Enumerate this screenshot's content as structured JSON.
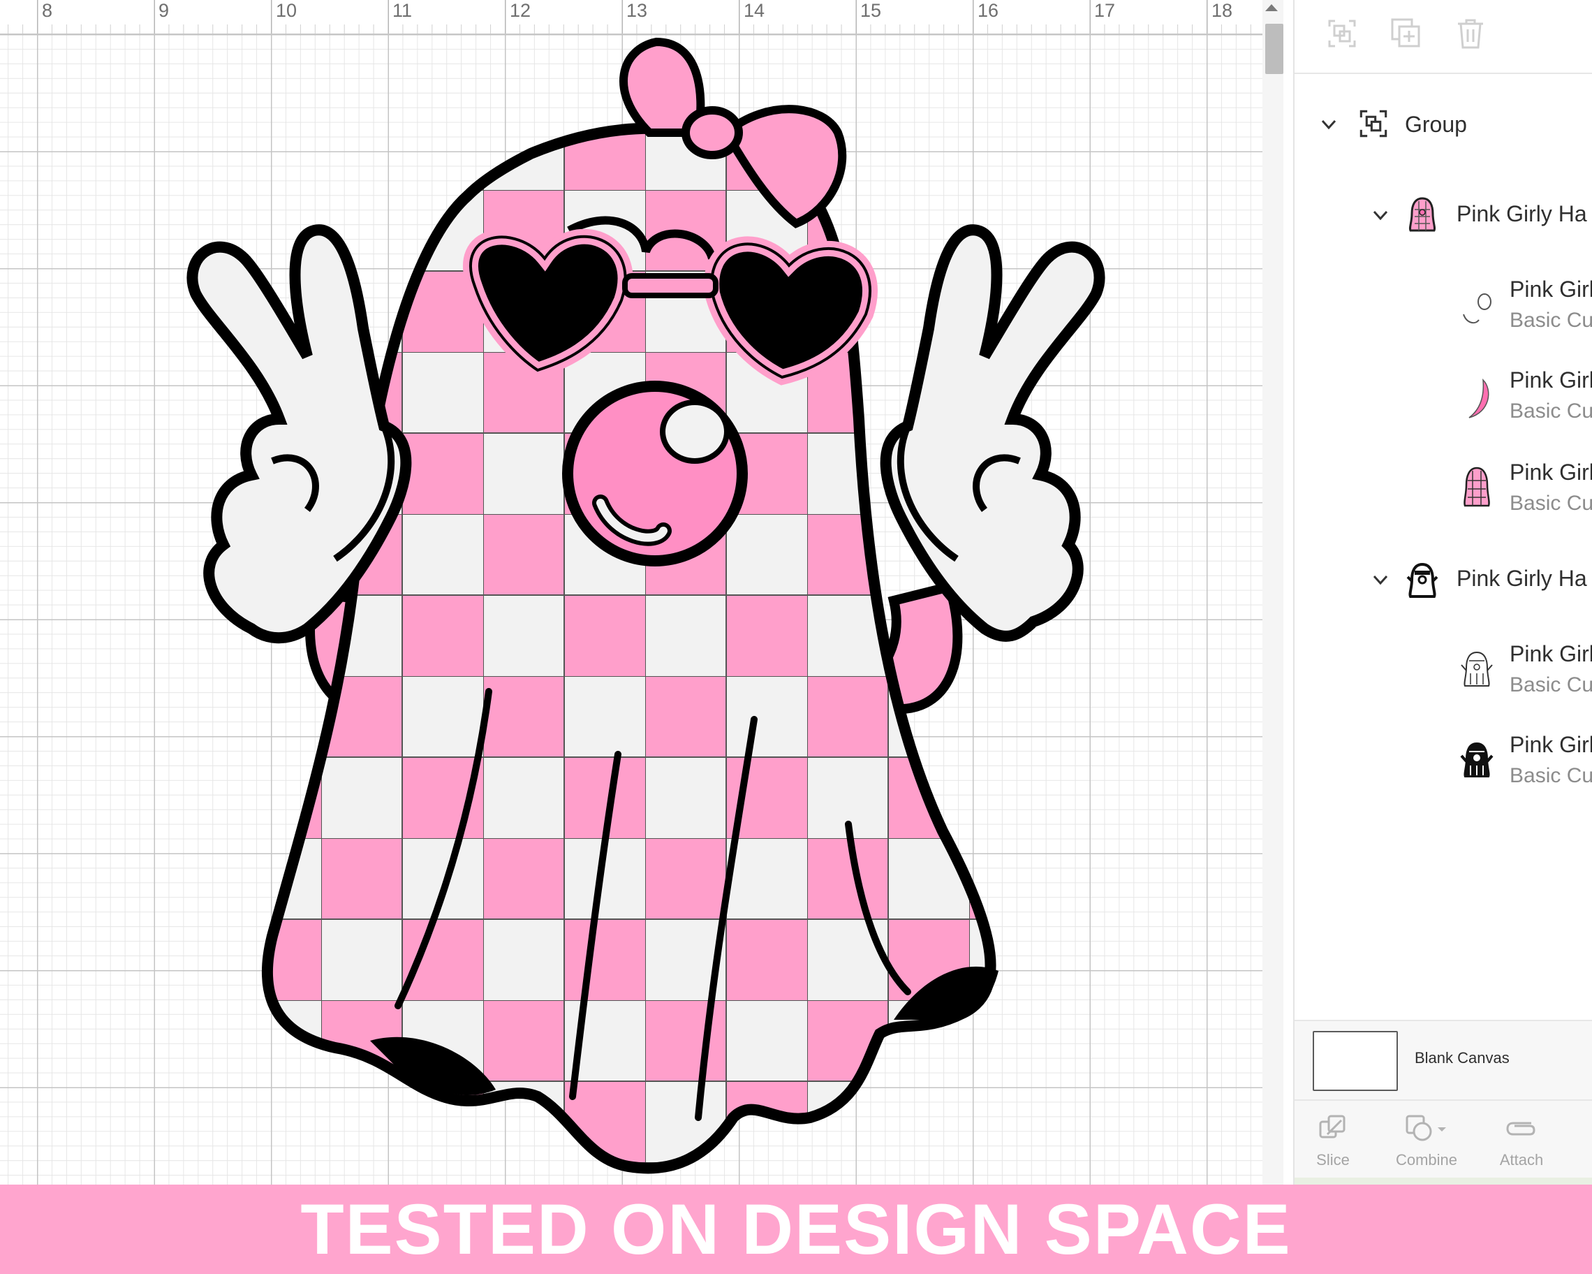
{
  "ruler": {
    "labels": [
      "8",
      "9",
      "10",
      "11",
      "12",
      "13",
      "14",
      "15",
      "16",
      "17",
      "18"
    ]
  },
  "artwork": {
    "icon": "pink-ghost-peace-sign-icon",
    "colors": {
      "pink": "#ff9fcb",
      "light": "#f2f2f2",
      "ink": "#000000",
      "bubble_gum": "#ff8fc4"
    }
  },
  "layers_panel": {
    "toolbar": {
      "icons": [
        "group-icon",
        "duplicate-icon",
        "delete-icon"
      ]
    },
    "group": {
      "label": "Group",
      "icon": "group-icon"
    },
    "subgroups": [
      {
        "label": "Pink Girly Ha",
        "icon": "ghost-color-thumb-icon",
        "children": [
          {
            "title": "Pink Girl",
            "subtitle": "Basic Cu",
            "icon": "bubble-outline-thumb-icon"
          },
          {
            "title": "Pink Girl",
            "subtitle": "Basic Cu",
            "icon": "crescent-pink-thumb-icon"
          },
          {
            "title": "Pink Girl",
            "subtitle": "Basic Cu",
            "icon": "ghost-pattern-thumb-icon"
          }
        ]
      },
      {
        "label": "Pink Girly Ha",
        "icon": "ghost-black-thumb-icon",
        "children": [
          {
            "title": "Pink Girl",
            "subtitle": "Basic Cu",
            "icon": "ghost-outline-thumb-icon"
          },
          {
            "title": "Pink Girl",
            "subtitle": "Basic Cu",
            "icon": "ghost-solid-thumb-icon"
          }
        ]
      }
    ],
    "canvas_label": "Blank Canvas",
    "actions": [
      {
        "label": "Slice",
        "icon": "slice-icon"
      },
      {
        "label": "Combine",
        "icon": "combine-icon"
      },
      {
        "label": "Attach",
        "icon": "attach-icon"
      }
    ]
  },
  "banner": {
    "text": "TESTED ON DESIGN SPACE",
    "color": "#ffa5ce"
  }
}
